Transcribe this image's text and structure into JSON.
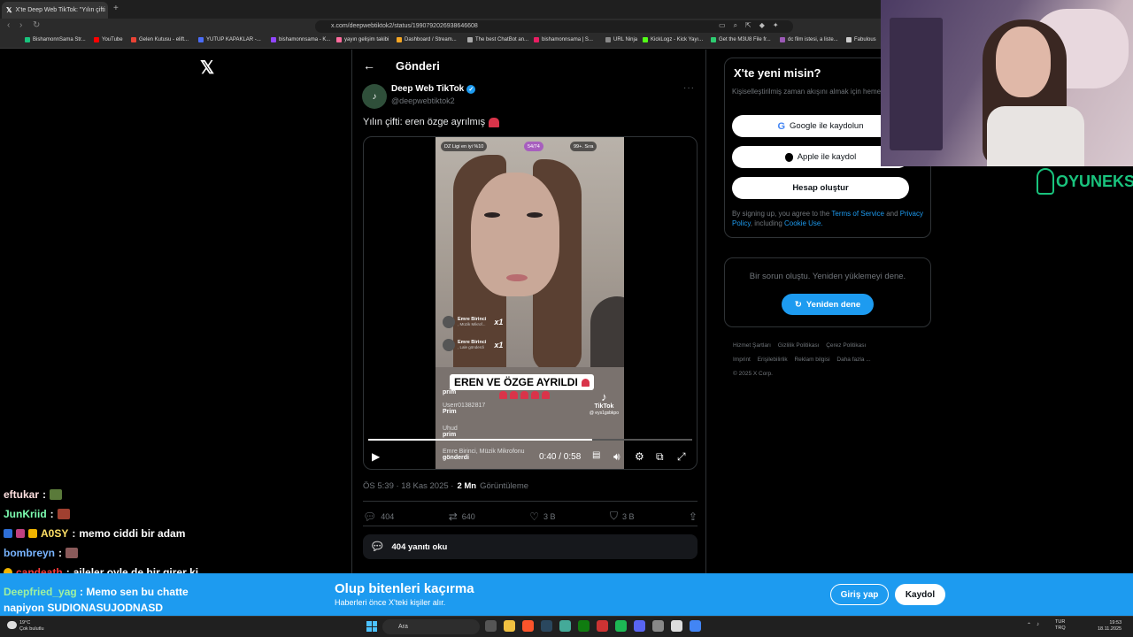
{
  "browser": {
    "tab_title": "X'te Deep Web TikTok: \"Yılın çifti",
    "url": "x.com/deepwebtiktok2/status/1990792026938646608",
    "bookmarks": [
      "BishamonnSama Str...",
      "YouTube",
      "Gelen Kutusu - elift...",
      "YUTUP KAPAKLAR -...",
      "bishamonnsama - K...",
      "yayın gelişim takibi",
      "Dashboard / Stream...",
      "The best ChatBot an...",
      "bishamonnsama | S...",
      "URL Ninja",
      "KickLogz - Kick Yayı...",
      "Get the M3U8 File fr...",
      "dc film istesi, a liste...",
      "Fabulous"
    ]
  },
  "post": {
    "page_title": "Gönderi",
    "author_name": "Deep Web TikTok",
    "author_handle": "@deepwebtiktok2",
    "text": "Yılın çifti: eren özge ayrılmış",
    "timestamp": "ÖS 5:39 · 18 Kas 2025 ·",
    "views_count": "2 Mn",
    "views_label": "Görüntüleme",
    "replies": "404",
    "reposts": "640",
    "likes": "3 B",
    "bookmarks": "3 B",
    "read_replies": "404 yanıtı oku"
  },
  "video": {
    "stat_left": "DZ Ligi en iyi %10",
    "stat_mid": "54/74",
    "stat_right": "99+. Sıra",
    "gift1_name": "Emre Birinci",
    "gift1_sub": ", Müzik Mikrof...",
    "gift2_name": "Emre Birinci",
    "gift2_sub": ", Lale gönderdi",
    "gift_mult": "x1",
    "caption": "EREN VE ÖZGE AYRILDI",
    "chat1_prefix": "prim",
    "chat2_user": "Userr01382817",
    "chat2_text": "Prim",
    "chat3_user": "Uhud",
    "chat3_text": "prim",
    "chat4_text": "Emre Birinci, Müzik Mikrofonu",
    "chat4_sub": "gönderdi",
    "tiktok_label": "TikTok",
    "tiktok_handle": "@ eys1gsbkpo",
    "time": "0:40 / 0:58",
    "progress": 0.69
  },
  "signup": {
    "title": "X'te yeni misin?",
    "desc": "Kişiselleştirilmiş zaman akışını almak için hemen kaydol!",
    "google": "Google ile kaydolun",
    "apple": "Apple ile kaydol",
    "create": "Hesap oluştur",
    "legal_prefix": "By signing up, you agree to the",
    "terms": "Terms of Service",
    "and": "and",
    "privacy": "Privacy Policy",
    "including": ", including",
    "cookie": "Cookie Use."
  },
  "error": {
    "text": "Bir sorun oluştu. Yeniden yüklemeyi dene.",
    "retry": "Yeniden dene"
  },
  "footer": {
    "links": [
      "Hizmet Şartları",
      "Gizlilik Politikası",
      "Çerez Politikası",
      "Imprint",
      "Erişilebilirlik",
      "Reklam bilgisi",
      "Daha fazla ..."
    ],
    "copyright": "© 2025 X Corp."
  },
  "overlay": {
    "brand": "OYUNEKS"
  },
  "chat": [
    {
      "user": "eftukar",
      "text": "",
      "color": "#ffe0e0"
    },
    {
      "user": "JunKriid",
      "text": "",
      "color": "#7dffb2"
    },
    {
      "user": "A0SY",
      "text": "memo ciddi bir adam",
      "color": "#ffe066"
    },
    {
      "user": "bombreyn",
      "text": "",
      "color": "#78b4ff"
    },
    {
      "user": "candeath",
      "text": "aileler oyle de bir girer ki",
      "color": "#ff3b3b"
    }
  ],
  "banner": {
    "title": "Olup bitenleri kaçırma",
    "subtitle": "Haberleri önce X'teki kişiler alır.",
    "login": "Giriş yap",
    "signup": "Kaydol",
    "chat_user": "Deepfried_yag",
    "chat_text": "Memo sen bu chatte",
    "chat_text2": "napiyon SUDIONASUJODNASD"
  },
  "taskbar": {
    "temp": "19°C",
    "weather": "Çok bulutlu",
    "search": "Ara",
    "lang": "TUR",
    "lang2": "TRQ",
    "time": "19:53",
    "date": "18.11.2025"
  },
  "colors": {
    "accent": "#1d9bf0",
    "background": "#000000",
    "muted": "#71767b"
  }
}
